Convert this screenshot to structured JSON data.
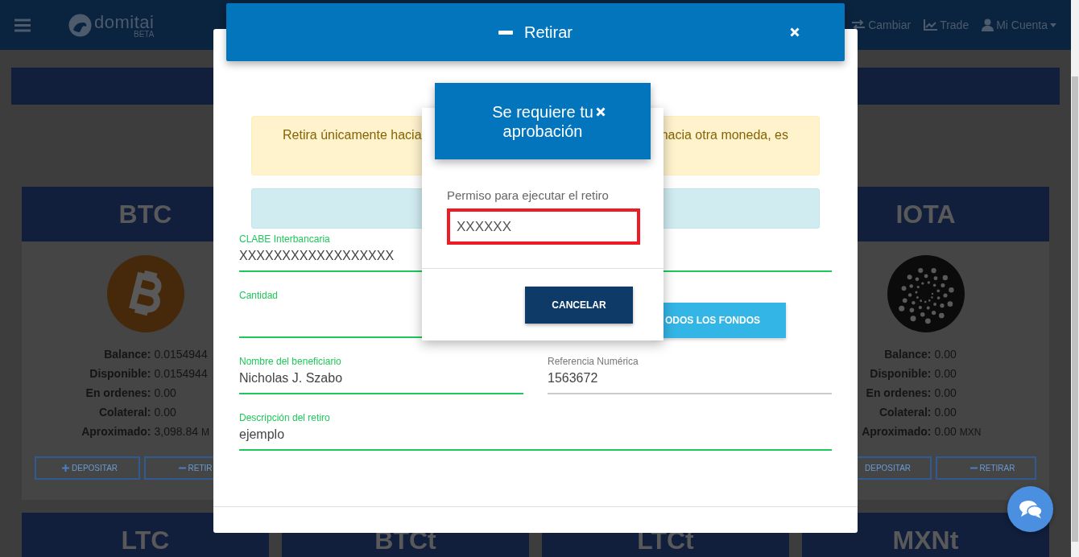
{
  "navbar": {
    "logo": {
      "name": "domitai",
      "tag": "BETA"
    },
    "links": [
      {
        "label": "Cambiar",
        "dropdown": false
      },
      {
        "label": "Trade",
        "dropdown": false
      },
      {
        "label": "Mi Cuenta",
        "dropdown": true
      }
    ]
  },
  "cards": [
    {
      "symbol": "BTC",
      "stats": [
        {
          "label": "Balance:",
          "value": "0.0154944"
        },
        {
          "label": "Disponible:",
          "value": "0.0154944"
        },
        {
          "label": "En ordenes:",
          "value": "0.00"
        },
        {
          "label": "Colateral:",
          "value": "0.00"
        },
        {
          "label": "Aproximado:",
          "value": "3,098.84",
          "unit": "M"
        }
      ],
      "buttons": [
        {
          "kind": "deposit",
          "label": "DEPOSITAR",
          "icon": true
        },
        {
          "kind": "withdraw",
          "label": "RETIR",
          "icon": true
        }
      ]
    },
    {
      "symbol": "IOTA",
      "stats": [
        {
          "label": "Balance:",
          "value": "0.00"
        },
        {
          "label": "Disponible:",
          "value": "0.00"
        },
        {
          "label": "En ordenes:",
          "value": "0.00"
        },
        {
          "label": "Colateral:",
          "value": "0.00"
        },
        {
          "label": "Aproximado:",
          "value": "0.00",
          "unit": "MXN"
        }
      ],
      "buttons": [
        {
          "kind": "deposit",
          "label": "DEPOSITAR",
          "icon": false
        },
        {
          "kind": "withdraw",
          "label": "RETIRAR",
          "icon": true
        }
      ]
    }
  ],
  "lower_cards": [
    {
      "symbol": "LTC"
    },
    {
      "symbol": "BTCt"
    },
    {
      "symbol": "LTCt"
    },
    {
      "symbol": "MXNt"
    }
  ],
  "withdraw_modal": {
    "title": "Retirar",
    "warning": [
      "Retira únicamente hacia",
      "hacia otra moneda, es"
    ],
    "fields": [
      {
        "label": "CLABE Interbancaria",
        "value": "XXXXXXXXXXXXXXXXXX",
        "valid": true
      },
      {
        "label": "Cantidad",
        "valid": true
      },
      {
        "label": "Nombre del beneficiario",
        "value": "Nicholas J. Szabo",
        "valid": true
      },
      {
        "label": "Referencia Numérica",
        "value": "1563672",
        "valid": false
      },
      {
        "label": "Descripción del retiro",
        "value": "ejemplo",
        "valid": true
      }
    ],
    "max_button": "ODOS LOS FONDOS"
  },
  "approval_modal": {
    "title": "Se requiere tu aprobación",
    "label": "Permiso para ejecutar el retiro",
    "value": "XXXXXX",
    "error": true,
    "button": "CANCELAR"
  }
}
